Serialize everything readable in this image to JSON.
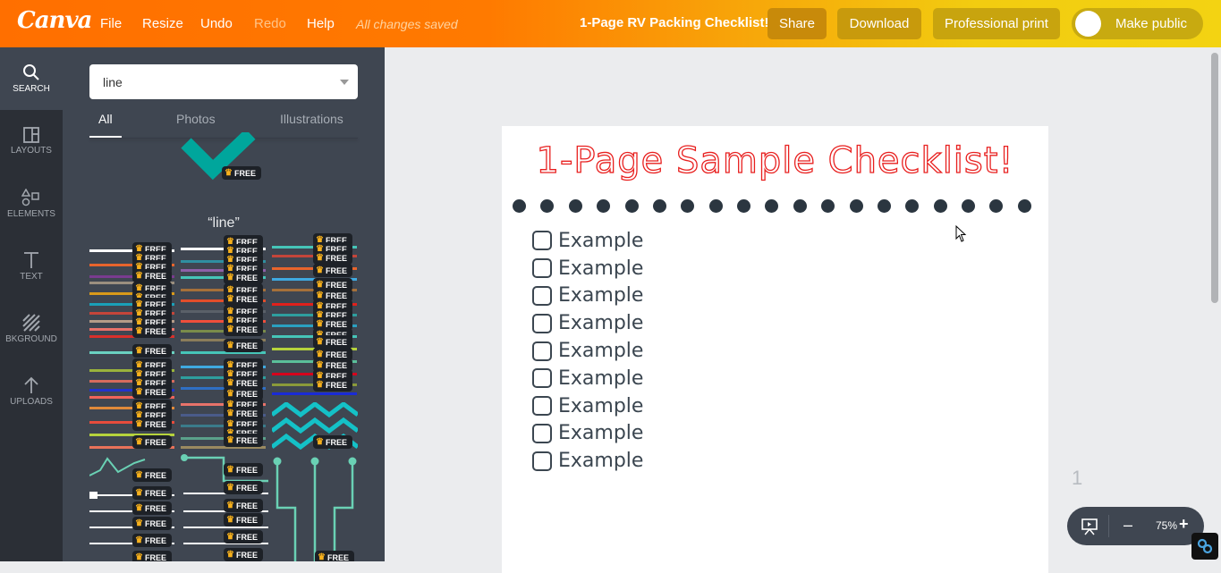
{
  "topbar": {
    "logo": "Canva",
    "menu": [
      "File",
      "Resize",
      "Undo",
      "Redo",
      "Help"
    ],
    "status": "All changes saved",
    "document_title": "1-Page RV Packing Checklist!",
    "buttons": {
      "share": "Share",
      "download": "Download",
      "professional_print": "Professional print",
      "make_public": "Make public"
    }
  },
  "leftnav": {
    "items": [
      {
        "label": "SEARCH",
        "icon": "search-icon",
        "active": true
      },
      {
        "label": "LAYOUTS",
        "icon": "layouts-icon"
      },
      {
        "label": "ELEMENTS",
        "icon": "elements-icon"
      },
      {
        "label": "TEXT",
        "icon": "text-icon"
      },
      {
        "label": "BKGROUND",
        "icon": "background-icon"
      },
      {
        "label": "UPLOADS",
        "icon": "upload-icon"
      }
    ]
  },
  "panel": {
    "search_value": "line",
    "tabs": [
      "All",
      "Photos",
      "Illustrations"
    ],
    "active_tab": "All",
    "result_heading": "“line”",
    "badge_label": "FREE"
  },
  "page": {
    "title": "1-Page Sample Checklist!",
    "dot_count": 19,
    "items": [
      "Example",
      "Example",
      "Example",
      "Example",
      "Example",
      "Example",
      "Example",
      "Example",
      "Example"
    ]
  },
  "footer": {
    "page_number": "1",
    "zoom": "75%",
    "zoom_minus": "–",
    "zoom_plus": "+"
  },
  "colors": {
    "title_red": "#e8201f",
    "accent_teal": "#00a69c",
    "dark_text": "#3b4650"
  }
}
